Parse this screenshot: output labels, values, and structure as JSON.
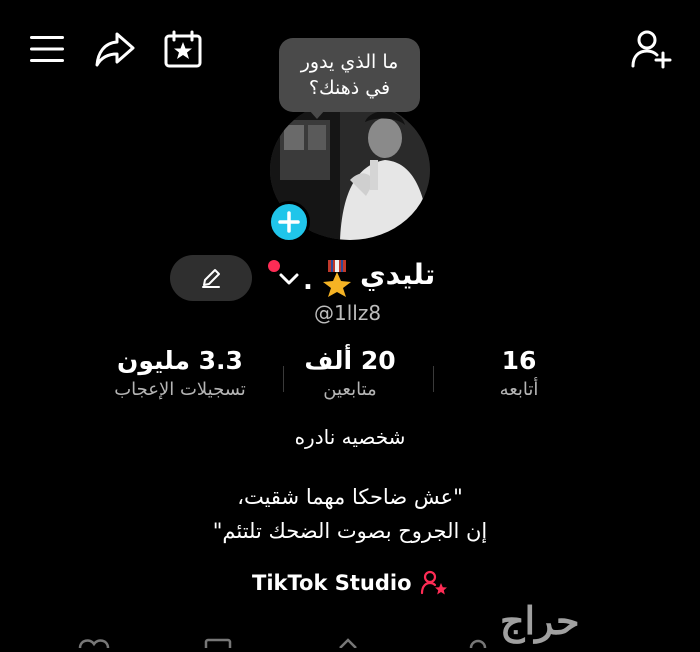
{
  "header": {
    "menu_icon": "hamburger-icon",
    "share_icon": "share-icon",
    "calendar_icon": "calendar-star-icon",
    "add_user_icon": "add-user-icon"
  },
  "bubble": {
    "line1": "ما الذي يدور",
    "line2": "في ذهنك؟"
  },
  "profile": {
    "display_name": "تليدي",
    "separator": ".",
    "username": "@1llz8"
  },
  "stats": {
    "following_value": "16",
    "following_label": "أتابعه",
    "followers_value": "20 ألف",
    "followers_label": "متابعين",
    "likes_value": "3.3 مليون",
    "likes_label": "تسجيلات الإعجاب"
  },
  "bio": {
    "title": "شخصيه نادره",
    "line1": "\"عش ضاحكا مهما شقيت،",
    "line2": "إن الجروح بصوت الضحك تلتئم\""
  },
  "studio": {
    "label": "TikTok Studio"
  },
  "watermark": "حراج",
  "colors": {
    "background": "#000000",
    "accent_blue": "#20c5ea",
    "accent_red": "#fe2c55",
    "bubble": "#4a4a4a",
    "edit_button": "#2f2f2f"
  }
}
